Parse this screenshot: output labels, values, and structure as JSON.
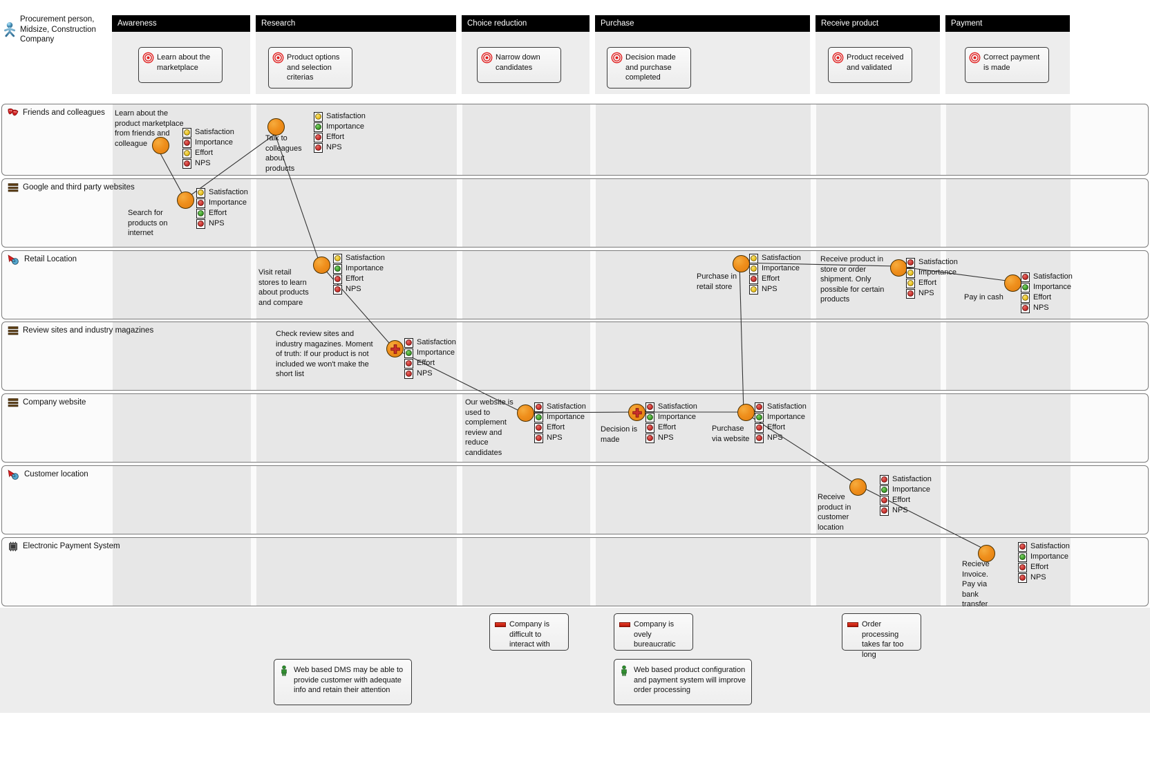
{
  "persona": {
    "icon": "person-icon",
    "label": "Procurement person, Midsize, Construction Company"
  },
  "phases": [
    {
      "name": "Awareness",
      "goal": "Learn about the marketplace"
    },
    {
      "name": "Research",
      "goal": "Product options and selection criterias"
    },
    {
      "name": "Choice reduction",
      "goal": "Narrow down candidates"
    },
    {
      "name": "Purchase",
      "goal": "Decision made and purchase completed"
    },
    {
      "name": "Receive product",
      "goal": "Product received and validated"
    },
    {
      "name": "Payment",
      "goal": "Correct payment is made"
    }
  ],
  "metric_names": [
    "Satisfaction",
    "Importance",
    "Effort",
    "NPS"
  ],
  "lanes": [
    {
      "name": "Friends and colleagues",
      "icon": "masks-icon",
      "touchpoints": [
        {
          "label": "Learn about the product marketplace from friends and colleague",
          "moment_of_truth": false,
          "metrics": [
            "yellow",
            "red",
            "yellow",
            "red"
          ]
        },
        {
          "label": "Talk to colleagues about products",
          "moment_of_truth": false,
          "metrics": [
            "yellow",
            "green",
            "red",
            "red"
          ]
        }
      ]
    },
    {
      "name": "Google and third party websites",
      "icon": "browser-icon",
      "touchpoints": [
        {
          "label": "Search for products on internet",
          "moment_of_truth": false,
          "metrics": [
            "yellow",
            "red",
            "green",
            "red"
          ]
        }
      ]
    },
    {
      "name": "Retail Location",
      "icon": "location-icon",
      "touchpoints": [
        {
          "label": "Visit retail stores to learn about products and compare",
          "moment_of_truth": false,
          "metrics": [
            "yellow",
            "green",
            "red",
            "red"
          ]
        },
        {
          "label": "Purchase in retail store",
          "moment_of_truth": false,
          "metrics": [
            "yellow",
            "yellow",
            "red",
            "yellow"
          ]
        },
        {
          "label": "Receive product in store or order shipment. Only possible for certain products",
          "moment_of_truth": false,
          "metrics": [
            "red",
            "yellow",
            "yellow",
            "red"
          ]
        },
        {
          "label": "Pay in cash",
          "moment_of_truth": false,
          "metrics": [
            "red",
            "green",
            "yellow",
            "red"
          ]
        }
      ]
    },
    {
      "name": "Review sites and industry magazines",
      "icon": "browser-icon",
      "touchpoints": [
        {
          "label": "Check review sites and industry magazines. Moment of truth: If our product is not included we won't make the short list",
          "moment_of_truth": true,
          "metrics": [
            "red",
            "green",
            "red",
            "red"
          ]
        }
      ]
    },
    {
      "name": "Company website",
      "icon": "browser-icon",
      "touchpoints": [
        {
          "label": "Our website is used to complement review and reduce candidates",
          "moment_of_truth": false,
          "metrics": [
            "red",
            "green",
            "red",
            "red"
          ]
        },
        {
          "label": "Decision is made",
          "moment_of_truth": true,
          "metrics": [
            "red",
            "green",
            "red",
            "red"
          ]
        },
        {
          "label": "Purchase via website",
          "moment_of_truth": false,
          "metrics": [
            "red",
            "green",
            "red",
            "red"
          ]
        }
      ]
    },
    {
      "name": "Customer location",
      "icon": "location-icon",
      "touchpoints": [
        {
          "label": "Receive product in customer location",
          "moment_of_truth": false,
          "metrics": [
            "red",
            "green",
            "red",
            "red"
          ]
        }
      ]
    },
    {
      "name": "Electronic Payment System",
      "icon": "chip-icon",
      "touchpoints": [
        {
          "label": "Recieve Invoice. Pay via bank transfer",
          "moment_of_truth": false,
          "metrics": [
            "red",
            "green",
            "red",
            "red"
          ]
        }
      ]
    }
  ],
  "pain_points": [
    {
      "text": "Company is difficult to interact with",
      "phase": "Choice reduction"
    },
    {
      "text": "Company is ovely bureaucratic",
      "phase": "Purchase"
    },
    {
      "text": "Order processing takes far too long",
      "phase": "Receive product"
    }
  ],
  "opportunities": [
    {
      "text": "Web based DMS may be able to provide customer with adequate info and retain their attention",
      "phase": "Research"
    },
    {
      "text": "Web based product configuration and payment system will improve order processing",
      "phase": "Purchase"
    }
  ],
  "colors": {
    "header_bg": "#000000",
    "header_text": "#ffffff",
    "touchpoint": "#ef8f1c",
    "red": "#c9302c",
    "yellow": "#e9c120",
    "green": "#3f9e2a",
    "pain": "#b31508",
    "lane_bg": "#fbfbfb",
    "band_bg": "#e7e7e7"
  }
}
